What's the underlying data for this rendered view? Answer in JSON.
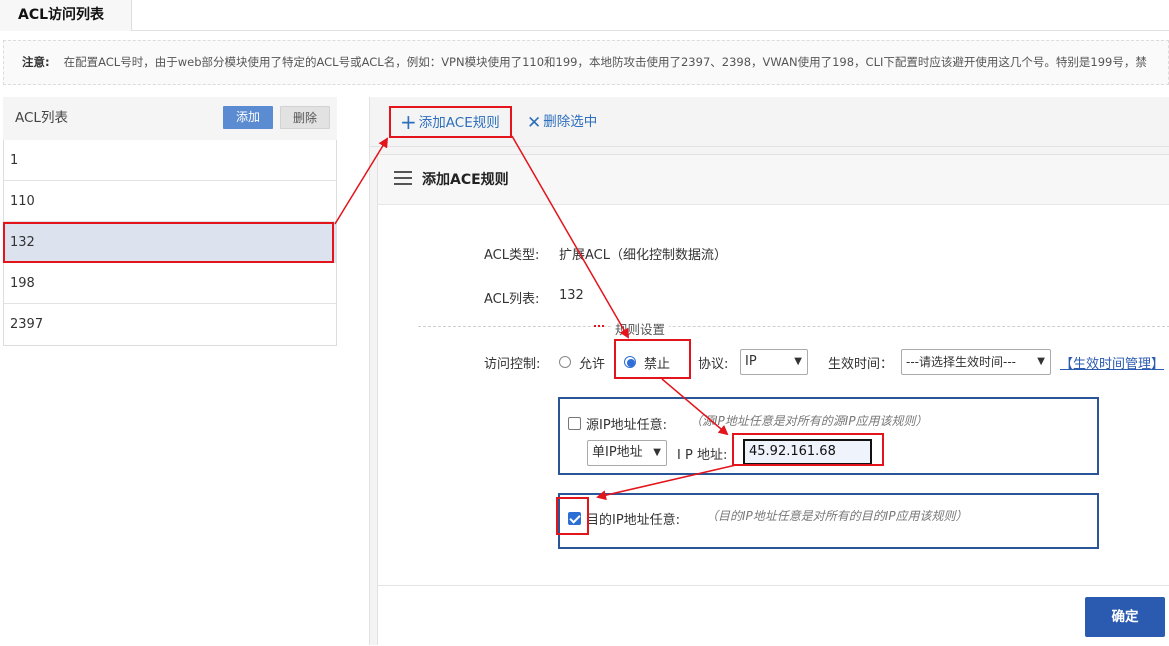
{
  "tab": {
    "title": "ACL访问列表"
  },
  "notice": {
    "label": "注意:",
    "text": "在配置ACL号时，由于web部分模块使用了特定的ACL号或ACL名，例如：VPN模块使用了110和199，本地防攻击使用了2397、2398，VWAN使用了198，CLI下配置时应该避开使用这几个号。特别是199号，禁"
  },
  "acl_list": {
    "title": "ACL列表",
    "add_label": "添加",
    "delete_label": "删除",
    "items": [
      "1",
      "110",
      "132",
      "198",
      "2397"
    ],
    "selected": "132"
  },
  "toolbar": {
    "add_ace_label": "添加ACE规则",
    "delete_selected_label": "删除选中"
  },
  "dialog": {
    "title": "添加ACE规则",
    "acl_type_label": "ACL类型:",
    "acl_type_value": "扩展ACL（细化控制数据流）",
    "acl_list_label": "ACL列表:",
    "acl_list_value": "132",
    "rule_section": "规则设置",
    "access_control_label": "访问控制:",
    "allow_label": "允许",
    "deny_label": "禁止",
    "access_selected": "禁止",
    "protocol_label": "协议:",
    "protocol_value": "IP",
    "effective_time_label": "生效时间：",
    "effective_time_value": "---请选择生效时间---",
    "time_manage_link": "【生效时间管理】",
    "source": {
      "any_label": "源IP地址任意:",
      "any_checked": false,
      "hint": "（源IP地址任意是对所有的源IP应用该规则）",
      "type_value": "单IP地址",
      "ip_label": "I P 地址:",
      "ip_value": "45.92.161.68"
    },
    "destination": {
      "any_label": "目的IP地址任意:",
      "any_checked": true,
      "hint": "（目的IP地址任意是对所有的目的IP应用该规则）"
    },
    "ok_label": "确定"
  },
  "colors": {
    "accent": "#2a5bb0",
    "annotation": "#e3141b"
  }
}
